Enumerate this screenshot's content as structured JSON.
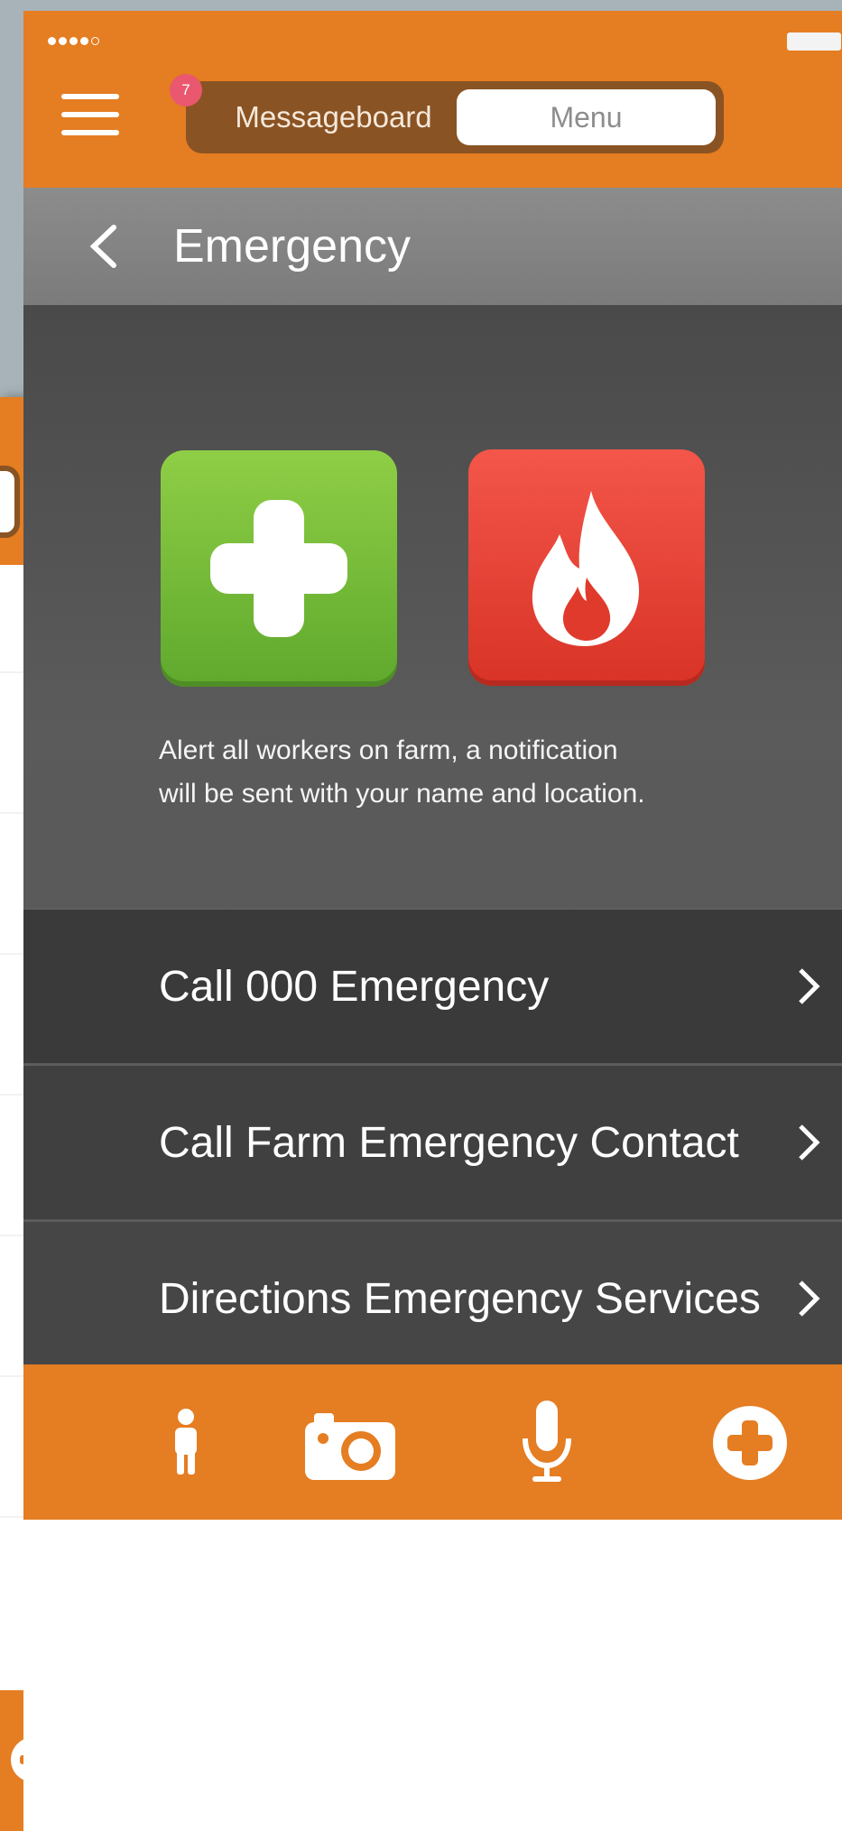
{
  "status_bar": {
    "signal_icon": "signal-dots-icon",
    "battery_icon": "battery-icon"
  },
  "header": {
    "menu_icon": "hamburger-menu-icon",
    "badge_count": "7",
    "segments": {
      "left": "Messageboard",
      "right": "Menu"
    }
  },
  "title_bar": {
    "back_icon": "chevron-left-icon",
    "title": "Emergency"
  },
  "emergency_buttons": [
    {
      "icon": "medical-cross-icon",
      "color": "#6fbb36"
    },
    {
      "icon": "fire-icon",
      "color": "#e8412f"
    }
  ],
  "alert_text": {
    "line1": "Alert all workers on farm, a notification",
    "line2": "will be sent with your name and location."
  },
  "rows": [
    {
      "label": "Call 000 Emergency"
    },
    {
      "label": "Call Farm Emergency Contact"
    },
    {
      "label": "Directions Emergency Services"
    }
  ],
  "bottom_bar": {
    "icons": [
      "person-icon",
      "camera-icon",
      "microphone-icon",
      "plus-circle-icon"
    ]
  },
  "background_phone": {
    "row_count": 7,
    "bottom_icon": "plus-circle-icon"
  },
  "colors": {
    "brand": "#e57d22",
    "segment_bg": "#8a5324",
    "badge": "#e9586e"
  }
}
